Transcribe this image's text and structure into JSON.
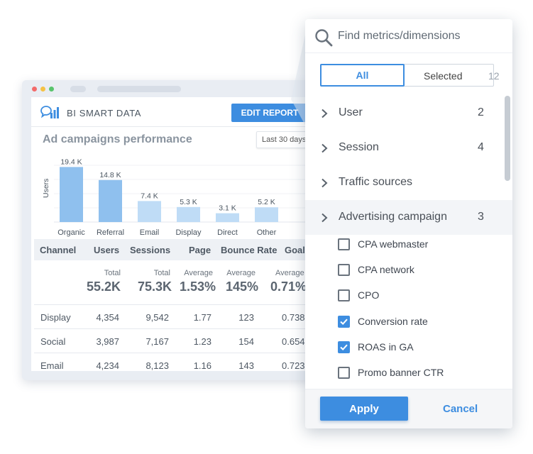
{
  "report": {
    "brand": "BI SMART DATA",
    "edit_button": "EDIT REPORT",
    "title": "Ad campaigns performance",
    "date_range": "Last 30 days",
    "colors": {
      "accent": "#3d8de0",
      "bar_strong": "#8fc0ee",
      "bar_light": "#bfdcf6"
    }
  },
  "chart_data": {
    "type": "bar",
    "title": "Ad campaigns performance",
    "ylabel": "Users",
    "categories": [
      "Organic",
      "Referral",
      "Email",
      "Display",
      "Direct",
      "Other"
    ],
    "values": [
      19.4,
      14.8,
      7.4,
      5.3,
      3.1,
      5.2
    ],
    "value_labels": [
      "19.4 K",
      "14.8 K",
      "7.4 K",
      "5.3 K",
      "3.1 K",
      "5.2 K"
    ],
    "unit": "K",
    "ylim": [
      0,
      20
    ],
    "grid": true
  },
  "table": {
    "headers": [
      "Channel",
      "Users",
      "Sessions",
      "Page",
      "Bounce Rate",
      "Goal"
    ],
    "totals": [
      {
        "label": "Total",
        "value": "55.2K"
      },
      {
        "label": "Total",
        "value": "75.3K"
      },
      {
        "label": "Average",
        "value": "1.53%"
      },
      {
        "label": "Average",
        "value": "145%"
      },
      {
        "label": "Average",
        "value": "0.71%"
      }
    ],
    "rows": [
      {
        "channel": "Display",
        "users": "4,354",
        "sessions": "9,542",
        "page": "1.77",
        "bounce": "123",
        "goal": "0.738"
      },
      {
        "channel": "Social",
        "users": "3,987",
        "sessions": "7,167",
        "page": "1.23",
        "bounce": "154",
        "goal": "0.654"
      },
      {
        "channel": "Email",
        "users": "4,234",
        "sessions": "8,123",
        "page": "1.16",
        "bounce": "143",
        "goal": "0.723"
      }
    ]
  },
  "picker": {
    "search_placeholder": "Find metrics/dimensions",
    "tab_all": "All",
    "tab_selected": "Selected",
    "selected_count": "12",
    "groups": [
      {
        "name": "User",
        "count": "2"
      },
      {
        "name": "Session",
        "count": "4"
      },
      {
        "name": "Traffic sources",
        "count": ""
      },
      {
        "name": "Advertising campaign",
        "count": "3"
      }
    ],
    "items": [
      {
        "label": "CPA webmaster",
        "checked": false
      },
      {
        "label": "CPA network",
        "checked": false
      },
      {
        "label": "CPO",
        "checked": false
      },
      {
        "label": "Conversion rate",
        "checked": true
      },
      {
        "label": "ROAS in GA",
        "checked": true
      },
      {
        "label": "Promo banner CTR",
        "checked": false
      }
    ],
    "apply": "Apply",
    "cancel": "Cancel"
  }
}
